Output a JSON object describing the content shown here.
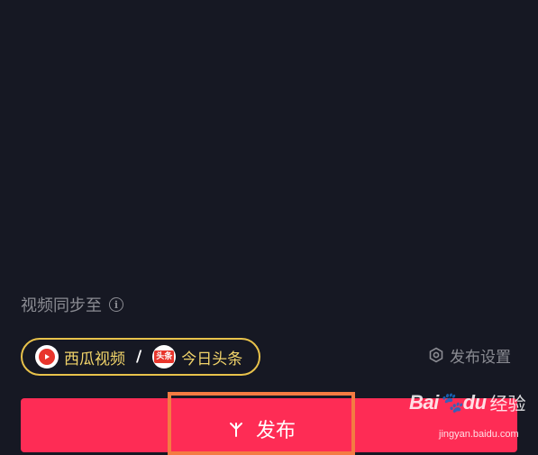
{
  "sync": {
    "label": "视频同步至",
    "info_icon": "info-icon",
    "platforms": [
      {
        "name": "西瓜视频",
        "icon": "xigua-video-icon"
      },
      {
        "name": "今日头条",
        "icon": "toutiao-icon",
        "badge": "头条"
      }
    ],
    "separator": "/"
  },
  "settings": {
    "label": "发布设置",
    "icon": "hexagon-settings-icon"
  },
  "publish": {
    "label": "发布",
    "icon": "sparkle-icon"
  },
  "watermark": {
    "logo": "Bai",
    "logo_suffix": "du",
    "text": "经验",
    "url": "jingyan.baidu.com"
  },
  "colors": {
    "background": "#161823",
    "publish_button": "#fe2c55",
    "highlight_border": "#f47b42",
    "pill_border": "#e8c24b",
    "pill_text": "#f2d46a",
    "muted_text": "#8b8c93"
  }
}
